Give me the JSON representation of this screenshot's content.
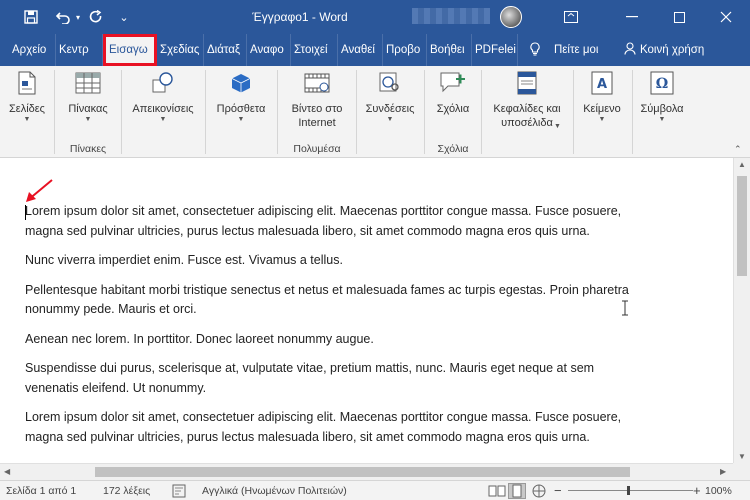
{
  "window": {
    "title": "Έγγραφο1 - Word"
  },
  "ribbon_tabs": [
    {
      "label": "Αρχείο"
    },
    {
      "label": "Κεντρ"
    },
    {
      "label": "Εισαγω"
    },
    {
      "label": "Σχεδίας"
    },
    {
      "label": "Διάταξ"
    },
    {
      "label": "Αναφο"
    },
    {
      "label": "Στοιχεί"
    },
    {
      "label": "Αναθεί"
    },
    {
      "label": "Προβο"
    },
    {
      "label": "Βοήθει"
    },
    {
      "label": "PDFelei"
    }
  ],
  "tell_me": "Πείτε μοι",
  "share": "Κοινή χρήση",
  "ribbon": {
    "pages": "Σελίδες",
    "tables": "Πίνακας",
    "tables_group": "Πίνακες",
    "illustrations": "Απεικονίσεις",
    "addins": "Πρόσθετα",
    "online_video": "Βίντεο στο Internet",
    "media_group": "Πολυμέσα",
    "links": "Συνδέσεις",
    "comment": "Σχόλια",
    "comments_group": "Σχόλια",
    "header_footer": "Κεφαλίδες και υποσέλιδα",
    "text": "Κείμενο",
    "symbols": "Σύμβολα"
  },
  "document": {
    "paragraphs": [
      "Lorem ipsum dolor sit amet, consectetuer adipiscing elit. Maecenas porttitor congue massa. Fusce posuere, magna sed pulvinar ultricies, purus lectus malesuada libero, sit amet commodo magna eros quis urna.",
      "Nunc viverra imperdiet enim. Fusce est. Vivamus a tellus.",
      "Pellentesque habitant morbi tristique senectus et netus et malesuada fames ac turpis egestas. Proin pharetra nonummy pede. Mauris et orci.",
      "Aenean nec lorem. In porttitor. Donec laoreet nonummy augue.",
      "Suspendisse dui purus, scelerisque at, vulputate vitae, pretium mattis, nunc. Mauris eget neque at sem venenatis eleifend. Ut nonummy.",
      "Lorem ipsum dolor sit amet, consectetuer adipiscing elit. Maecenas porttitor congue massa. Fusce posuere, magna sed pulvinar ultricies, purus lectus malesuada libero, sit amet commodo magna eros quis urna."
    ]
  },
  "status": {
    "page": "Σελίδα 1 από 1",
    "words": "172 λέξεις",
    "language": "Αγγλικά (Ηνωμένων Πολιτειών)",
    "zoom": "100%",
    "zoom_minus": "−",
    "zoom_plus": "+"
  },
  "colors": {
    "accent": "#2b579a",
    "highlight": "#e81123"
  }
}
